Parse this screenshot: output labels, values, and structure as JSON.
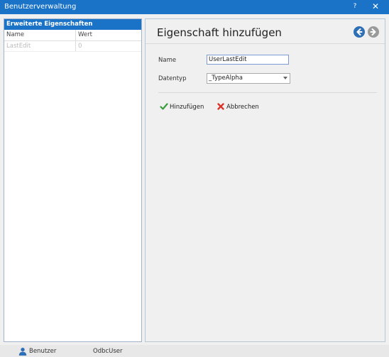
{
  "window": {
    "title": "Benutzerverwaltung",
    "help_label": "?",
    "close_label": "✕"
  },
  "left_panel": {
    "header": "Erweiterte Eigenschaften",
    "columns": [
      "Name",
      "Wert"
    ],
    "rows": [
      {
        "name": "LastEdit",
        "value": "0"
      }
    ]
  },
  "right_panel": {
    "title": "Eigenschaft hinzufügen",
    "name_label": "Name",
    "name_value": "UserLastEdit",
    "type_label": "Datentyp",
    "type_value": "_TypeAlpha",
    "add_label": "Hinzufügen",
    "cancel_label": "Abbrechen",
    "icons": {
      "back": "arrow-left-circle-icon",
      "forward": "arrow-right-circle-icon"
    },
    "colors": {
      "accent": "#1a73c7",
      "add_icon": "#3a9b3a",
      "cancel_icon": "#d9342b"
    }
  },
  "status": {
    "user_label": "Benutzer",
    "odbc_label": "OdbcUser"
  }
}
